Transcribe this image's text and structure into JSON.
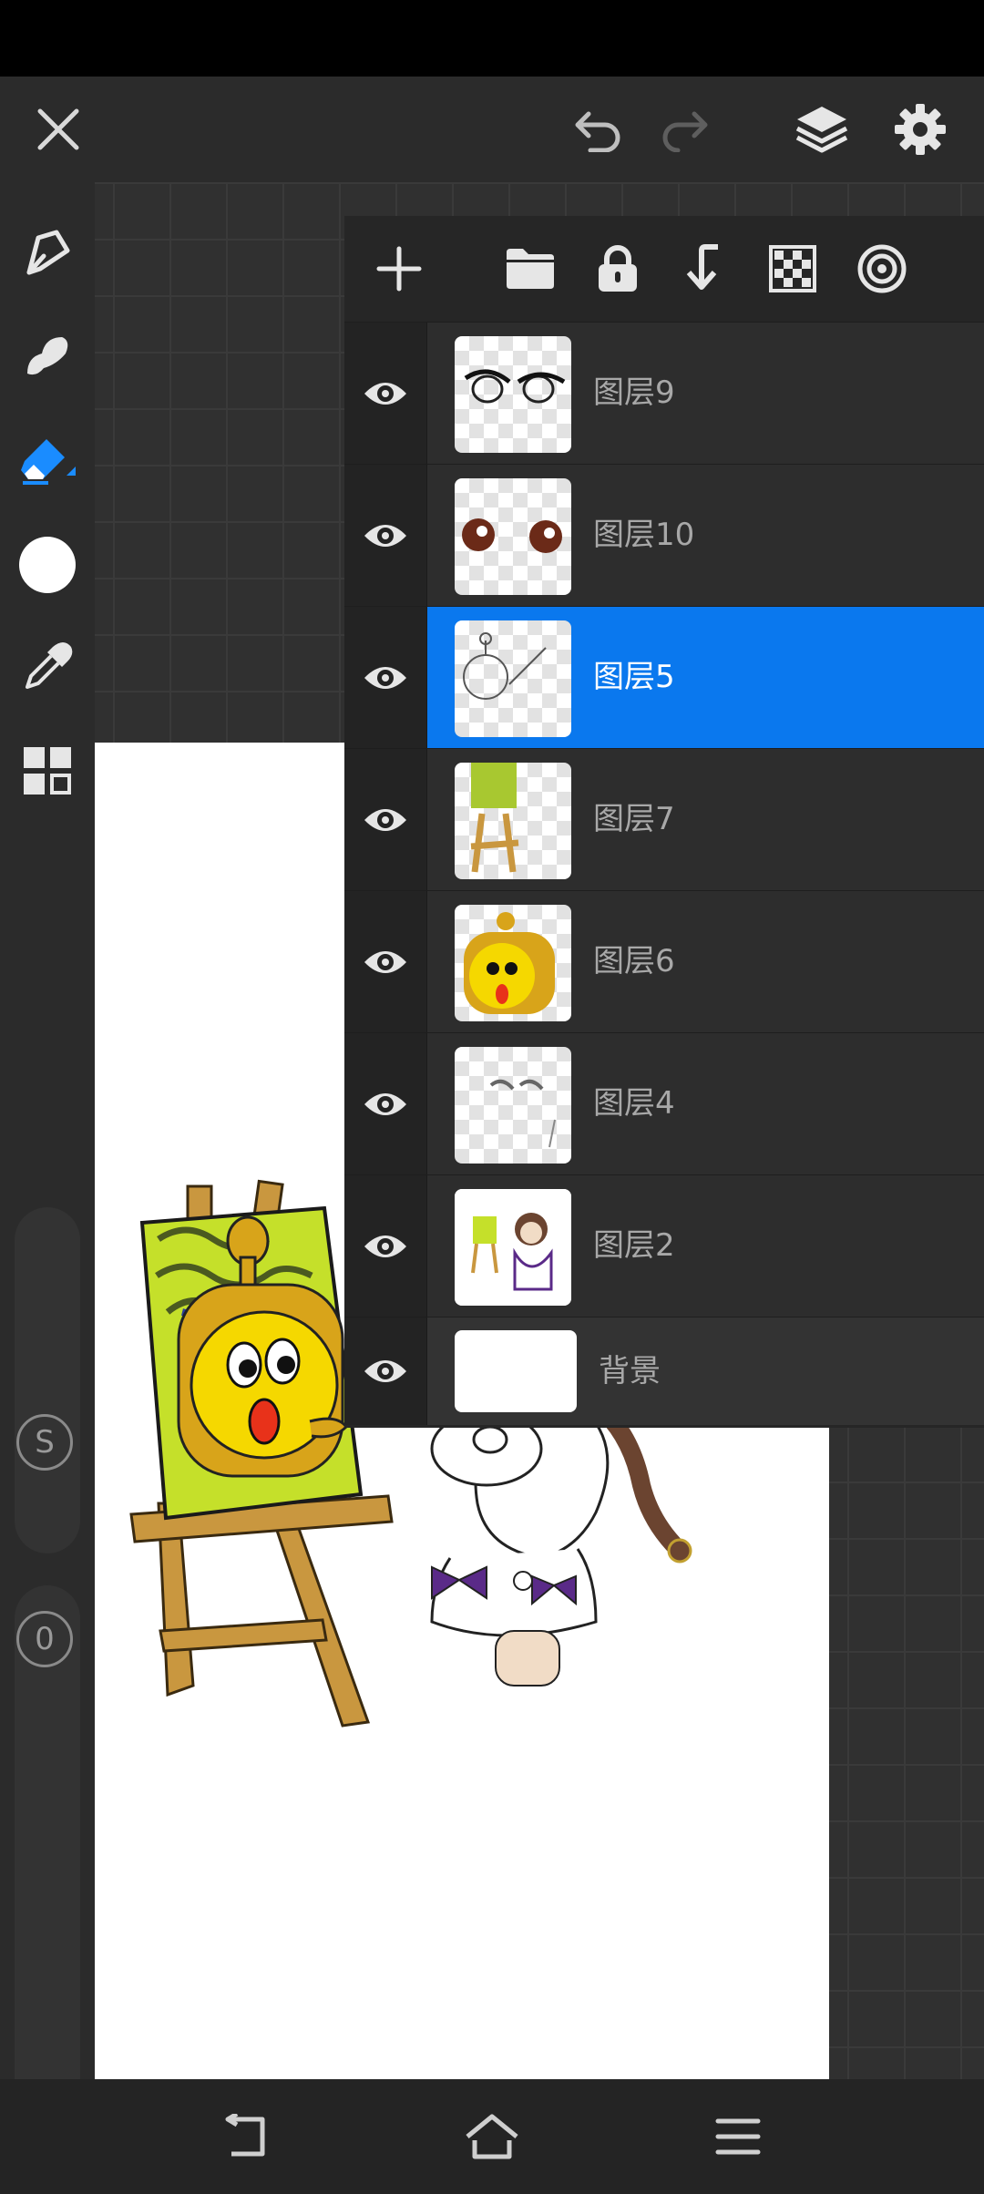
{
  "app": {
    "accent": "#0a78ee"
  },
  "topbar": {
    "icons": [
      "close-icon",
      "undo-icon",
      "redo-icon",
      "layers-icon",
      "settings-icon"
    ]
  },
  "tools": [
    "pen-icon",
    "smudge-icon",
    "eraser-icon",
    "color-swatch",
    "eyedropper-icon",
    "gallery-icon"
  ],
  "side_controls": {
    "size_label": "S",
    "opacity_label": "0"
  },
  "layer_panel": {
    "toolbar_icons": [
      "add-layer-icon",
      "folder-icon",
      "lock-icon",
      "merge-down-icon",
      "transparency-icon",
      "blend-icon"
    ],
    "layers": [
      {
        "name": "图层9",
        "visible": true,
        "selected": false
      },
      {
        "name": "图层10",
        "visible": true,
        "selected": false
      },
      {
        "name": "图层5",
        "visible": true,
        "selected": true
      },
      {
        "name": "图层7",
        "visible": true,
        "selected": false
      },
      {
        "name": "图层6",
        "visible": true,
        "selected": false
      },
      {
        "name": "图层4",
        "visible": true,
        "selected": false
      },
      {
        "name": "图层2",
        "visible": true,
        "selected": false
      },
      {
        "name": "背景",
        "visible": true,
        "selected": false
      }
    ]
  },
  "navbar": {
    "icons": [
      "back-icon",
      "home-icon",
      "menu-icon"
    ]
  }
}
